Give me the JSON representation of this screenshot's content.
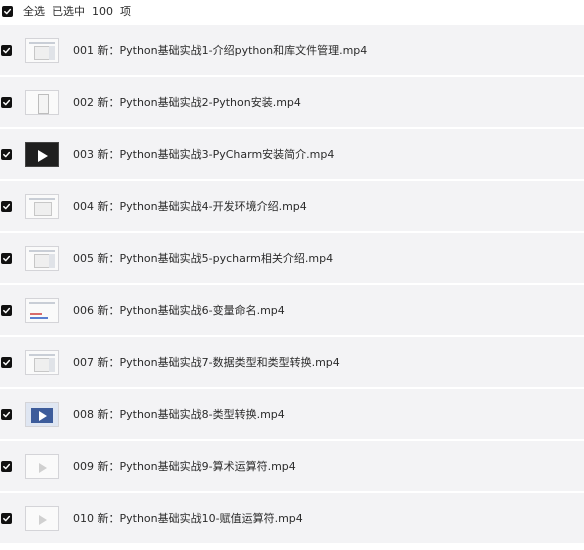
{
  "header": {
    "select_all": "全选",
    "selected_label": "已选中",
    "selected_count": "100",
    "unit": "项"
  },
  "files": [
    {
      "name": "001 新：Python基础实战1-介绍python和库文件管理.mp4",
      "thumb": "window-icon"
    },
    {
      "name": "002 新：Python基础实战2-Python安装.mp4",
      "thumb": "installer-icon"
    },
    {
      "name": "003 新：Python基础实战3-PyCharm安装简介.mp4",
      "thumb": "video-play-icon"
    },
    {
      "name": "004 新：Python基础实战4-开发环境介绍.mp4",
      "thumb": "window-icon"
    },
    {
      "name": "005 新：Python基础实战5-pycharm相关介绍.mp4",
      "thumb": "window-icon"
    },
    {
      "name": "006 新：Python基础实战6-变量命名.mp4",
      "thumb": "code-icon"
    },
    {
      "name": "007 新：Python基础实战7-数据类型和类型转换.mp4",
      "thumb": "window-icon"
    },
    {
      "name": "008 新：Python基础实战8-类型转换.mp4",
      "thumb": "video-play-icon"
    },
    {
      "name": "009 新：Python基础实战9-算术运算符.mp4",
      "thumb": "video-play-icon"
    },
    {
      "name": "010 新：Python基础实战10-赋值运算符.mp4",
      "thumb": "video-play-icon"
    }
  ]
}
